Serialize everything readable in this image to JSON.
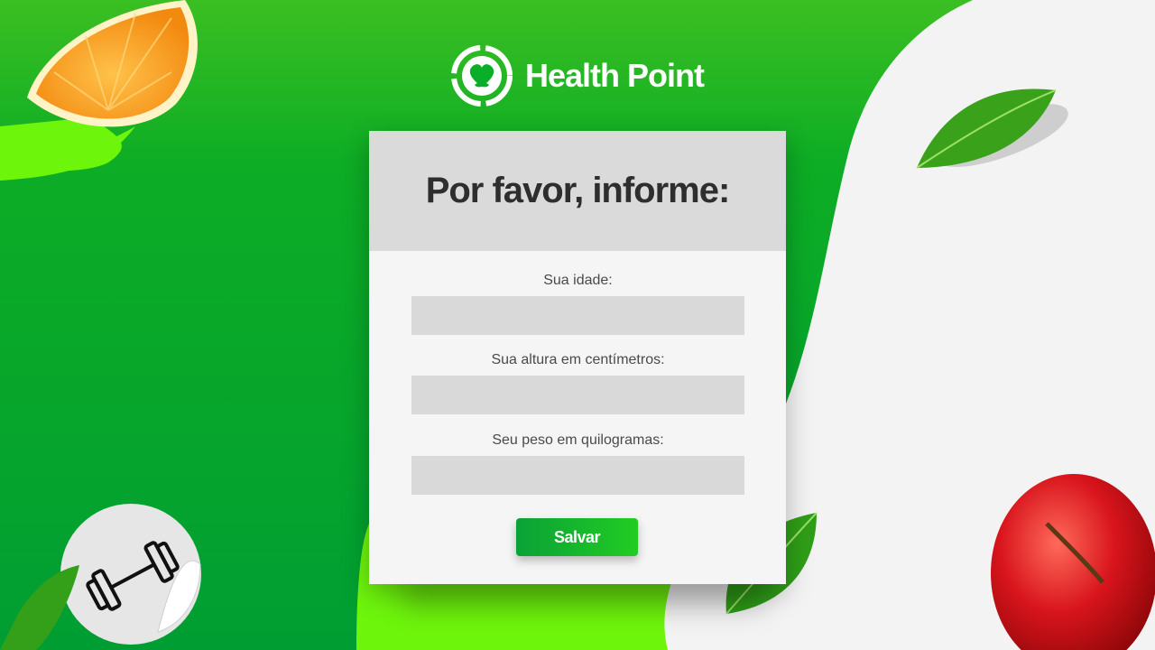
{
  "brand": {
    "name": "Health Point",
    "logo_icon": "heart-leaf-icon"
  },
  "form": {
    "heading": "Por favor, informe:",
    "fields": [
      {
        "label": "Sua idade:",
        "value": ""
      },
      {
        "label": "Sua altura em centímetros:",
        "value": ""
      },
      {
        "label": "Seu peso em quilogramas:",
        "value": ""
      }
    ],
    "submit_label": "Salvar"
  },
  "colors": {
    "primary_green": "#09a92a",
    "lime": "#6ef50c",
    "card": "#f5f5f5",
    "card_header": "#dadada",
    "input": "#d9d9d9"
  }
}
